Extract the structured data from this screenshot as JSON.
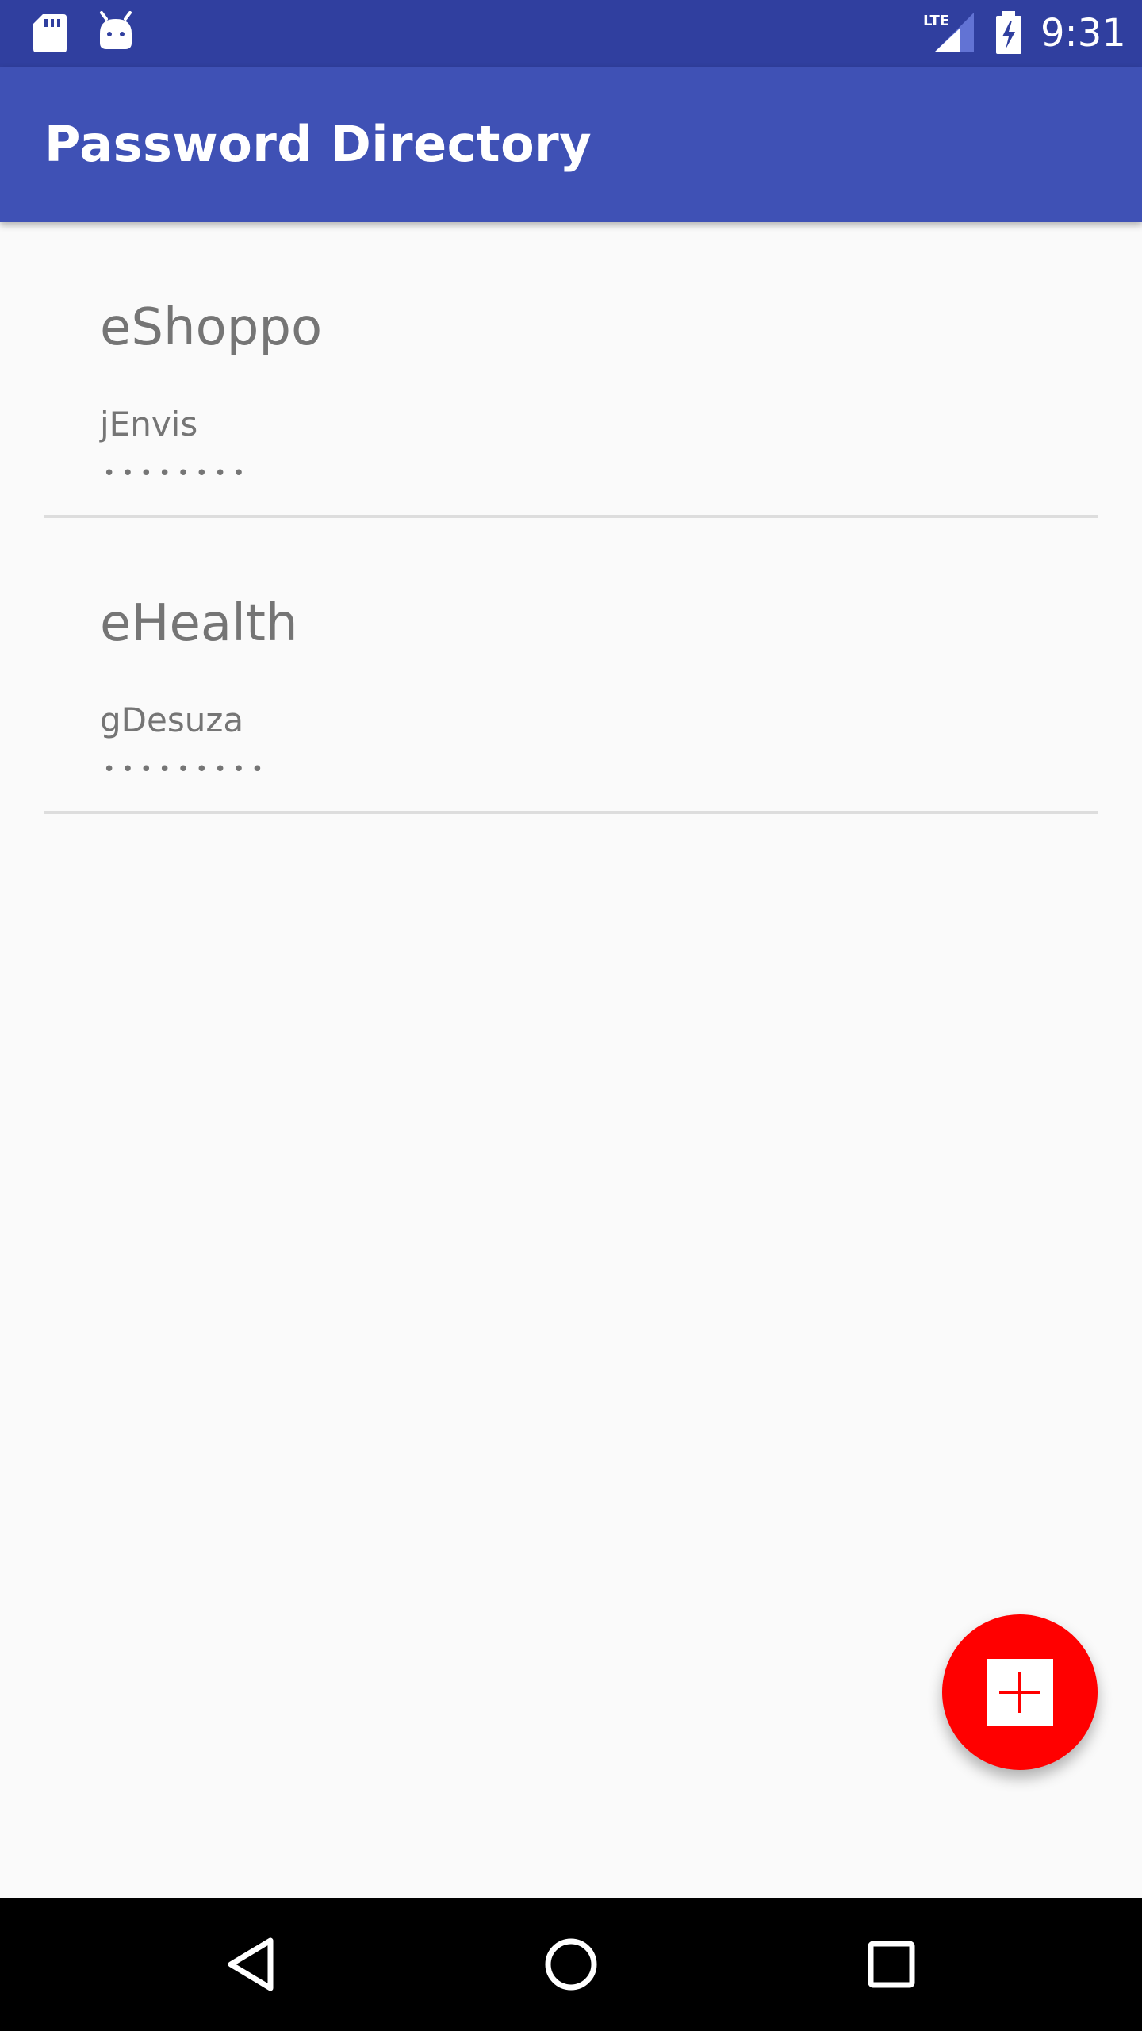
{
  "status_bar": {
    "time": "9:31",
    "network_label": "LTE",
    "icons": [
      "sd-card-icon",
      "android-icon",
      "lte-signal-icon",
      "battery-charging-icon"
    ]
  },
  "app_bar": {
    "title": "Password Directory"
  },
  "entries": [
    {
      "site": "eShoppo",
      "username": "jEnvis",
      "password_mask": "••••••••"
    },
    {
      "site": "eHealth",
      "username": "gDesuza",
      "password_mask": "•••••••••"
    }
  ],
  "fab": {
    "icon": "add-icon",
    "color": "#ff0000"
  },
  "nav_bar": {
    "icons": [
      "back-icon",
      "home-icon",
      "recents-icon"
    ]
  },
  "colors": {
    "status_bar": "#303f9f",
    "app_bar": "#3f51b5",
    "background": "#fafafa",
    "text_secondary": "#757575",
    "divider": "#dddddd"
  }
}
